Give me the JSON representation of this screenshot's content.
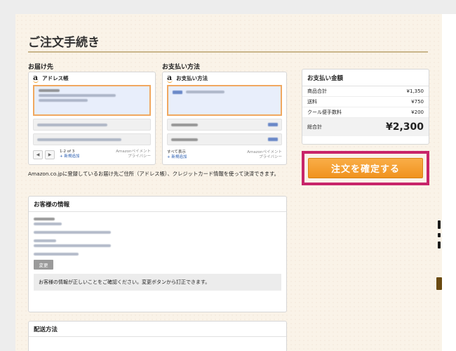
{
  "page": {
    "title": "ご注文手続き"
  },
  "address": {
    "section_label": "お届け先",
    "card_title": "アドレス帳",
    "pager": "1-2 of 3",
    "add_link": "+ 新規追加",
    "widget_brand": "Amazonペイメント",
    "privacy": "プライバシー"
  },
  "payment": {
    "section_label": "お支払い方法",
    "card_title": "お支払い方法",
    "show_all": "すべて表示",
    "add_link": "+ 新規追加",
    "widget_brand": "Amazonペイメント",
    "privacy": "プライバシー"
  },
  "info_text": "Amazon.co.jpに登録しているお届け先ご住所（アドレス帳）、クレジットカード情報を使って決済できます。",
  "customer": {
    "title": "お客様の情報",
    "change_label": "変更",
    "notice": "お客様の情報が正しいことをご確認ください。変更ボタンから訂正できます。"
  },
  "shipping": {
    "title": "配送方法"
  },
  "summary": {
    "title": "お支払い金額",
    "rows": [
      {
        "label": "商品合計",
        "value": "¥1,350"
      },
      {
        "label": "送料",
        "value": "¥750"
      },
      {
        "label": "クール便手数料",
        "value": "¥200"
      }
    ],
    "total_label": "総合計",
    "total_value": "¥2,300"
  },
  "confirm_label": "注文を確定する",
  "colors": {
    "accent_orange": "#f0931e",
    "highlight_frame": "#c8256a",
    "page_bg": "#faf3e8"
  }
}
